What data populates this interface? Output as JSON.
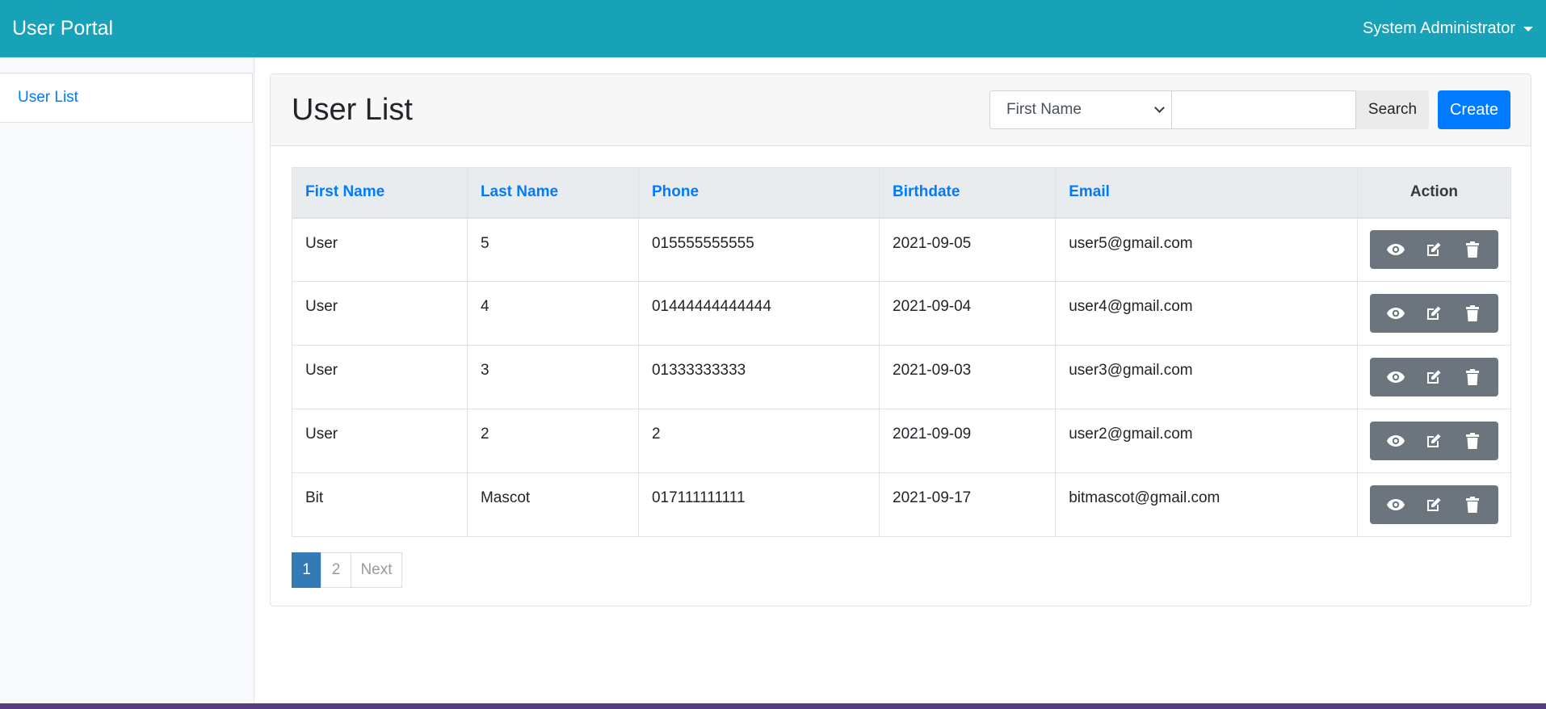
{
  "navbar": {
    "brand": "User Portal",
    "user_menu": "System Administrator"
  },
  "sidebar": {
    "items": [
      {
        "label": "User List"
      }
    ]
  },
  "card": {
    "title": "User List",
    "search": {
      "field_selected": "First Name",
      "input_value": "",
      "search_label": "Search",
      "create_label": "Create"
    }
  },
  "table": {
    "columns": [
      "First Name",
      "Last Name",
      "Phone",
      "Birthdate",
      "Email",
      "Action"
    ],
    "rows": [
      {
        "first": "User",
        "last": "5",
        "phone": "015555555555",
        "birthdate": "2021-09-05",
        "email": "user5@gmail.com"
      },
      {
        "first": "User",
        "last": "4",
        "phone": "01444444444444",
        "birthdate": "2021-09-04",
        "email": "user4@gmail.com"
      },
      {
        "first": "User",
        "last": "3",
        "phone": "01333333333",
        "birthdate": "2021-09-03",
        "email": "user3@gmail.com"
      },
      {
        "first": "User",
        "last": "2",
        "phone": "2",
        "birthdate": "2021-09-09",
        "email": "user2@gmail.com"
      },
      {
        "first": "Bit",
        "last": "Mascot",
        "phone": "017111111111",
        "birthdate": "2021-09-17",
        "email": "bitmascot@gmail.com"
      }
    ],
    "row_actions": [
      "eye-icon",
      "edit-icon",
      "trash-icon"
    ]
  },
  "pagination": {
    "pages": [
      "1",
      "2"
    ],
    "active": "1",
    "next_label": "Next"
  },
  "colors": {
    "navbar": "#17a2b8",
    "primary": "#007bff",
    "action_group": "#6c757d",
    "pagination_active": "#337ab7"
  }
}
